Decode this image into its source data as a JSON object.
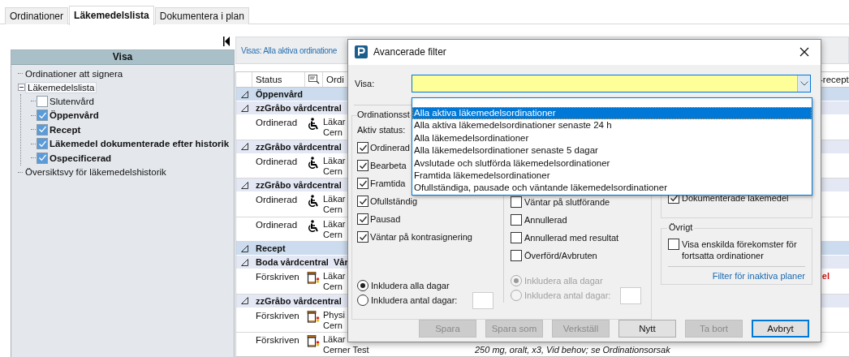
{
  "tabs": [
    {
      "label": "Ordinationer",
      "selected": false
    },
    {
      "label": "Läkemedelslista",
      "selected": true
    },
    {
      "label": "Dokumentera i plan",
      "selected": false
    }
  ],
  "sidebar": {
    "title": "Visa",
    "items": [
      {
        "label": "Ordinationer att signera",
        "selected": false
      },
      {
        "label": "Läkemedelslista",
        "selected": true,
        "expanded": true,
        "children": [
          {
            "label": "Slutenvård",
            "checked": false,
            "selected": false
          },
          {
            "label": "Öppenvård",
            "checked": true,
            "selected": false
          },
          {
            "label": "Recept",
            "checked": true,
            "selected": false
          },
          {
            "label": "Läkemedel dokumenterade efter historik",
            "checked": true,
            "selected": false
          },
          {
            "label": "Ospecificerad",
            "checked": true,
            "selected": false
          }
        ]
      },
      {
        "label": "Översiktsvy för läkemedelshistorik",
        "selected": false
      }
    ]
  },
  "info_bar": {
    "text": "Visas: Alla aktiva ordinatione"
  },
  "table": {
    "columns": [
      "Status",
      "Ordi"
    ],
    "right_column": "-recept",
    "rows": [
      {
        "kind": "group",
        "label": "Öppenvård"
      },
      {
        "kind": "subgroup",
        "label": "zzGråbo vårdcentral"
      },
      {
        "kind": "ordination",
        "status": "Ordinerad",
        "line1": "Läkar",
        "line2": "Cern"
      },
      {
        "kind": "subgroup",
        "label": "zzGråbo vårdcentral"
      },
      {
        "kind": "ordination",
        "status": "Ordinerad",
        "line1": "Läkar",
        "line2": "Cern"
      },
      {
        "kind": "subgroup",
        "label": "zzGråbo vårdcentral"
      },
      {
        "kind": "ordination",
        "status": "Ordinerad",
        "line1": "Läkar",
        "line2": "Cern"
      },
      {
        "kind": "ordination",
        "status": "Ordinerad",
        "line1": "Läkar",
        "line2": "Cern"
      },
      {
        "kind": "group",
        "label": "Recept"
      },
      {
        "kind": "subgroup",
        "label": "Boda vårdcentral  Vår"
      },
      {
        "kind": "prescription",
        "status": "Förskriven",
        "line1": "Läkar",
        "line2": "Cern",
        "note": "el"
      },
      {
        "kind": "subgroup",
        "label": "zzGråbo vårdcentral"
      },
      {
        "kind": "prescription",
        "status": "Förskriven",
        "line1": "Physi",
        "line2": "Cern"
      },
      {
        "kind": "prescription",
        "status": "Förskriven",
        "line1": "Läkar",
        "line2": "Cerner Test",
        "detail": "250 mg, oralt, x3, Vid behov; se Ordinationsorsak"
      }
    ]
  },
  "dialog": {
    "title": "Avancerade filter",
    "visa_label": "Visa:",
    "dropdown": {
      "items": [
        {
          "label": "Alla aktiva läkemedelsordinationer",
          "selected": true
        },
        {
          "label": "Alla aktiva läkemedelsordinationer senaste 24 h",
          "selected": false
        },
        {
          "label": "Alla läkemedelsordinationer",
          "selected": false
        },
        {
          "label": "Alla läkemedelsordinationer senaste 5 dagar",
          "selected": false
        },
        {
          "label": "Avslutade och slutförda läkemedelsordinationer",
          "selected": false
        },
        {
          "label": "Framtida läkemedelsordinationer",
          "selected": false
        },
        {
          "label": "Ofullständiga, pausade och väntande läkemedelsordinationer",
          "selected": false
        }
      ]
    },
    "status_group": {
      "title": "Ordinationsst",
      "active_label": "Aktiv status:",
      "active": [
        {
          "label": "Ordinerad",
          "checked": true
        },
        {
          "label": "Bearbeta",
          "checked": true
        },
        {
          "label": "Framtida",
          "checked": true
        },
        {
          "label": "Ofullständig",
          "checked": true
        },
        {
          "label": "Pausad",
          "checked": true
        },
        {
          "label": "Väntar på kontrasignering",
          "checked": true
        }
      ],
      "active_days": [
        {
          "label": "Inkludera alla dagar",
          "selected": true
        },
        {
          "label": "Inkludera antal dagar:",
          "selected": false
        }
      ],
      "inactive": [
        {
          "label": "Väntar på slutförande",
          "checked": false
        },
        {
          "label": "Annullerad",
          "checked": false
        },
        {
          "label": "Annullerad med resultat",
          "checked": false
        },
        {
          "label": "Överförd/Avbruten",
          "checked": false
        }
      ],
      "inactive_days": [
        {
          "label": "Inkludera alla dagar",
          "selected": true
        },
        {
          "label": "Inkludera antal dagar:",
          "selected": false
        }
      ],
      "inactive_days_disabled": true
    },
    "documented": {
      "label": "Dokumenterade läkemedel",
      "checked": true
    },
    "other": {
      "title": "Övrigt",
      "checkbox": {
        "label": "Visa enskilda förekomster för fortsatta ordinationer",
        "checked": false
      },
      "link": "Filter för inaktiva planer"
    },
    "buttons": [
      {
        "label": "Spara",
        "disabled": true,
        "default": false
      },
      {
        "label": "Spara som",
        "disabled": true,
        "default": false
      },
      {
        "label": "Verkställ",
        "disabled": true,
        "default": false
      },
      {
        "label": "Nytt",
        "disabled": false,
        "default": false
      },
      {
        "label": "Ta bort",
        "disabled": true,
        "default": false
      },
      {
        "label": "Avbryt",
        "disabled": false,
        "default": true
      }
    ]
  }
}
